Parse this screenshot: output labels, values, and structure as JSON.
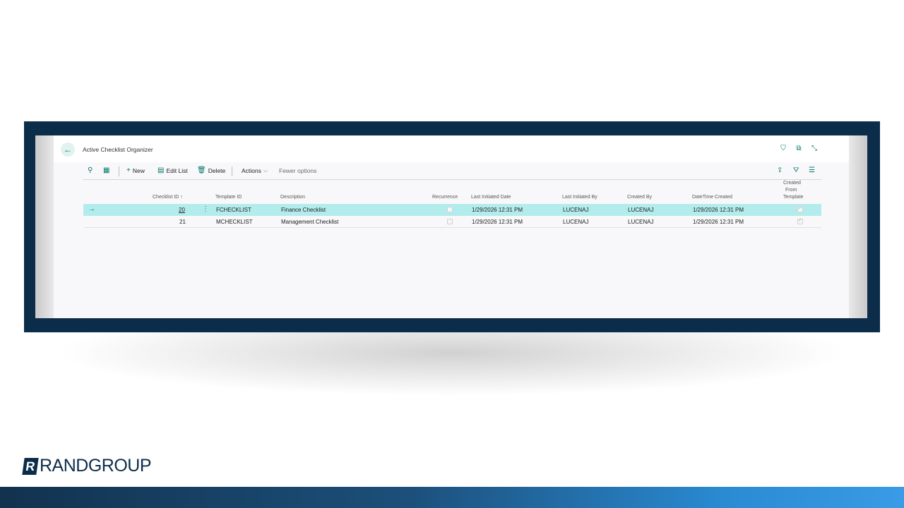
{
  "page": {
    "title": "Active Checklist Organizer"
  },
  "actions": {
    "new": "New",
    "edit_list": "Edit List",
    "delete": "Delete",
    "actions": "Actions",
    "fewer_options": "Fewer options"
  },
  "table": {
    "headers": {
      "checklist_id": "Checklist ID ↑",
      "template_id": "Template ID",
      "description": "Description",
      "recurrence": "Recurrence",
      "last_initiated_date": "Last Initiated Date",
      "last_initiated_by": "Last Initiated By",
      "created_by": "Created By",
      "datetime_created": "DateTime Created",
      "created_from_template_1": "Created",
      "created_from_template_2": "From",
      "created_from_template_3": "Template"
    },
    "rows": [
      {
        "checklist_id": "20",
        "template_id": "FCHECKLIST",
        "description": "Finance Checklist",
        "recurrence": false,
        "last_initiated_date": "1/29/2026 12:31 PM",
        "last_initiated_by": "LUCENAJ",
        "created_by": "LUCENAJ",
        "datetime_created": "1/29/2026 12:31 PM",
        "created_from_template": true
      },
      {
        "checklist_id": "21",
        "template_id": "MCHECKLIST",
        "description": "Management Checklist",
        "recurrence": false,
        "last_initiated_date": "1/29/2026 12:31 PM",
        "last_initiated_by": "LUCENAJ",
        "created_by": "LUCENAJ",
        "datetime_created": "1/29/2026 12:31 PM",
        "created_from_template": true
      }
    ]
  },
  "brand": {
    "logo_letter": "R",
    "name_bold": "RAND",
    "name_light": "GROUP"
  },
  "colors": {
    "frame": "#0c2d49",
    "accent": "#00776a",
    "selected_row": "#b3ecec"
  }
}
